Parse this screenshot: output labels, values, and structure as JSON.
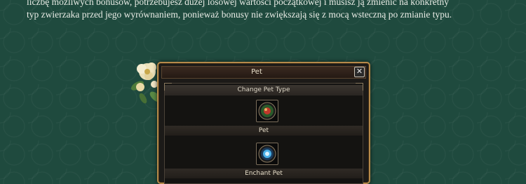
{
  "article": {
    "line1": "liczbę możliwych bonusów, potrzebujesz dużej losowej wartości początkowej i musisz ją zmienić na konkretny",
    "line2": "typ zwierzaka przed jego wyrównaniem, ponieważ bonusy nie zwiększają się z mocą wsteczną po zmianie typu."
  },
  "window": {
    "title": "Pet",
    "close_label": "✕",
    "section_title": "Change Pet Type",
    "slots": [
      {
        "label": "Pet",
        "icon": "pet-item-icon"
      },
      {
        "label": "Enchant Pet",
        "icon": "enchant-orb-icon"
      }
    ]
  },
  "colors": {
    "background": "#1f4a3e",
    "window_border": "#b58a4a",
    "text": "#e6ddc8"
  }
}
